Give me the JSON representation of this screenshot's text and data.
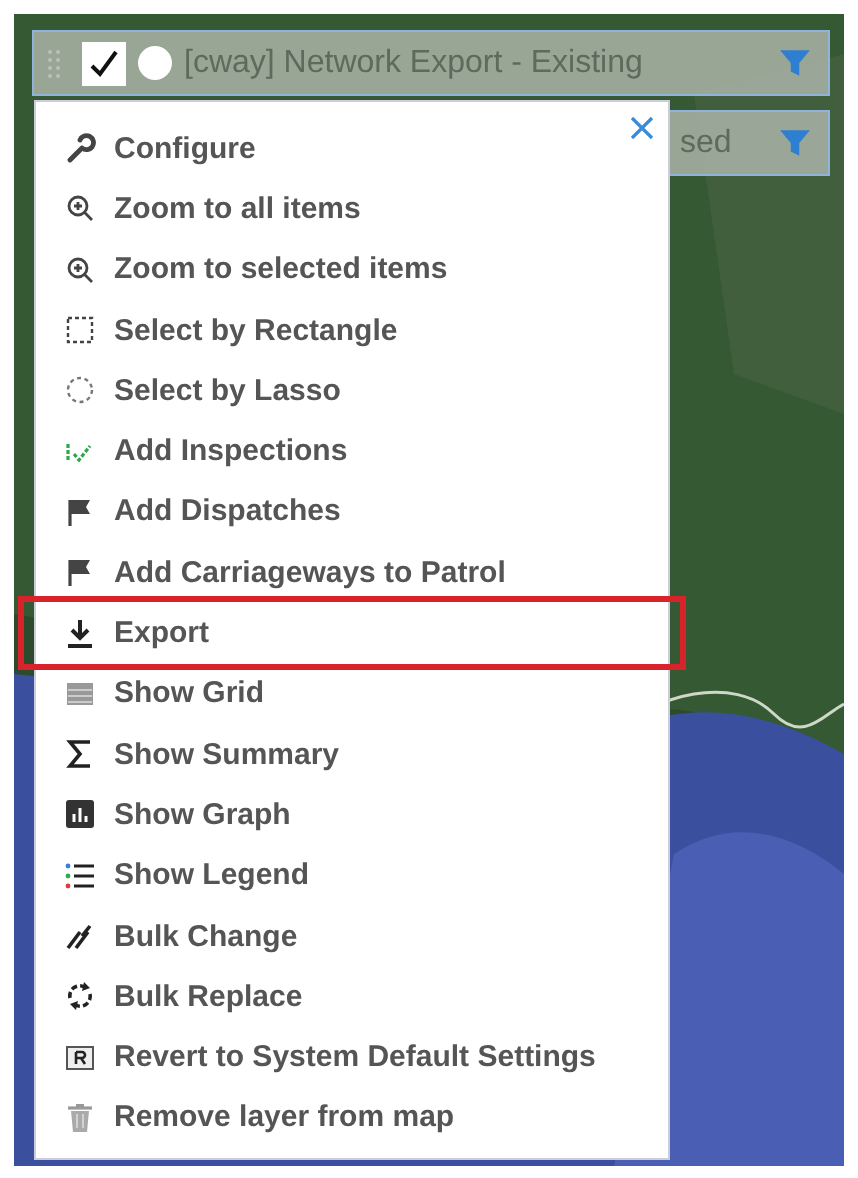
{
  "layer_bar": {
    "checked": true,
    "radio_selected": false,
    "title": "[cway] Network Export - Existing"
  },
  "layer_bar_behind": {
    "title": "sed"
  },
  "menu": {
    "items": [
      {
        "label": "Configure",
        "highlighted": false
      },
      {
        "label": "Zoom to all items",
        "highlighted": false
      },
      {
        "label": "Zoom to selected items",
        "highlighted": false
      },
      {
        "label": "Select by Rectangle",
        "highlighted": false
      },
      {
        "label": "Select by Lasso",
        "highlighted": false
      },
      {
        "label": "Add Inspections",
        "highlighted": false
      },
      {
        "label": "Add Dispatches",
        "highlighted": false
      },
      {
        "label": "Add Carriageways to Patrol",
        "highlighted": false
      },
      {
        "label": "Export",
        "highlighted": true
      },
      {
        "label": "Show Grid",
        "highlighted": false
      },
      {
        "label": "Show Summary",
        "highlighted": false
      },
      {
        "label": "Show Graph",
        "highlighted": false
      },
      {
        "label": "Show Legend",
        "highlighted": false
      },
      {
        "label": "Bulk Change",
        "highlighted": false
      },
      {
        "label": "Bulk Replace",
        "highlighted": false
      },
      {
        "label": "Revert to System Default Settings",
        "highlighted": false
      },
      {
        "label": "Remove layer from map",
        "highlighted": false
      }
    ]
  }
}
